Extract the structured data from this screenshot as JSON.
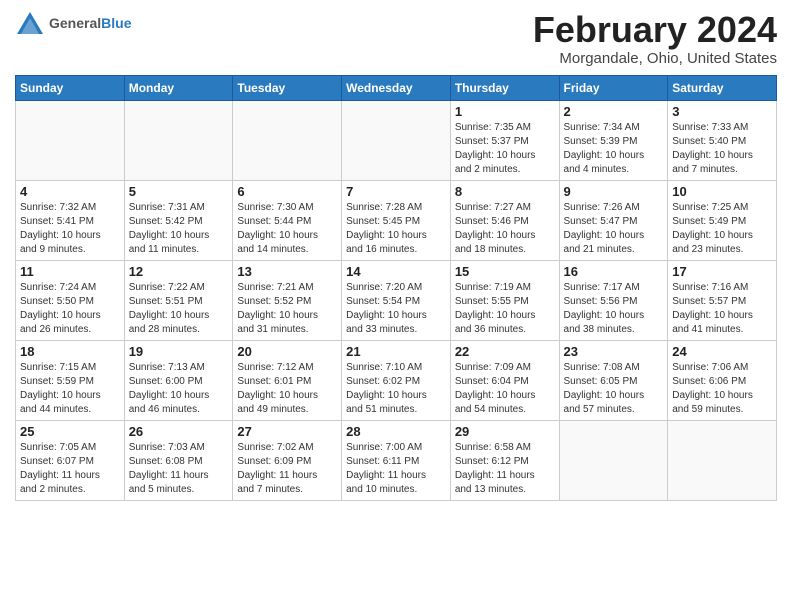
{
  "header": {
    "logo_general": "General",
    "logo_blue": "Blue",
    "main_title": "February 2024",
    "subtitle": "Morgandale, Ohio, United States"
  },
  "calendar": {
    "days_of_week": [
      "Sunday",
      "Monday",
      "Tuesday",
      "Wednesday",
      "Thursday",
      "Friday",
      "Saturday"
    ],
    "weeks": [
      [
        {
          "num": "",
          "info": ""
        },
        {
          "num": "",
          "info": ""
        },
        {
          "num": "",
          "info": ""
        },
        {
          "num": "",
          "info": ""
        },
        {
          "num": "1",
          "info": "Sunrise: 7:35 AM\nSunset: 5:37 PM\nDaylight: 10 hours\nand 2 minutes."
        },
        {
          "num": "2",
          "info": "Sunrise: 7:34 AM\nSunset: 5:39 PM\nDaylight: 10 hours\nand 4 minutes."
        },
        {
          "num": "3",
          "info": "Sunrise: 7:33 AM\nSunset: 5:40 PM\nDaylight: 10 hours\nand 7 minutes."
        }
      ],
      [
        {
          "num": "4",
          "info": "Sunrise: 7:32 AM\nSunset: 5:41 PM\nDaylight: 10 hours\nand 9 minutes."
        },
        {
          "num": "5",
          "info": "Sunrise: 7:31 AM\nSunset: 5:42 PM\nDaylight: 10 hours\nand 11 minutes."
        },
        {
          "num": "6",
          "info": "Sunrise: 7:30 AM\nSunset: 5:44 PM\nDaylight: 10 hours\nand 14 minutes."
        },
        {
          "num": "7",
          "info": "Sunrise: 7:28 AM\nSunset: 5:45 PM\nDaylight: 10 hours\nand 16 minutes."
        },
        {
          "num": "8",
          "info": "Sunrise: 7:27 AM\nSunset: 5:46 PM\nDaylight: 10 hours\nand 18 minutes."
        },
        {
          "num": "9",
          "info": "Sunrise: 7:26 AM\nSunset: 5:47 PM\nDaylight: 10 hours\nand 21 minutes."
        },
        {
          "num": "10",
          "info": "Sunrise: 7:25 AM\nSunset: 5:49 PM\nDaylight: 10 hours\nand 23 minutes."
        }
      ],
      [
        {
          "num": "11",
          "info": "Sunrise: 7:24 AM\nSunset: 5:50 PM\nDaylight: 10 hours\nand 26 minutes."
        },
        {
          "num": "12",
          "info": "Sunrise: 7:22 AM\nSunset: 5:51 PM\nDaylight: 10 hours\nand 28 minutes."
        },
        {
          "num": "13",
          "info": "Sunrise: 7:21 AM\nSunset: 5:52 PM\nDaylight: 10 hours\nand 31 minutes."
        },
        {
          "num": "14",
          "info": "Sunrise: 7:20 AM\nSunset: 5:54 PM\nDaylight: 10 hours\nand 33 minutes."
        },
        {
          "num": "15",
          "info": "Sunrise: 7:19 AM\nSunset: 5:55 PM\nDaylight: 10 hours\nand 36 minutes."
        },
        {
          "num": "16",
          "info": "Sunrise: 7:17 AM\nSunset: 5:56 PM\nDaylight: 10 hours\nand 38 minutes."
        },
        {
          "num": "17",
          "info": "Sunrise: 7:16 AM\nSunset: 5:57 PM\nDaylight: 10 hours\nand 41 minutes."
        }
      ],
      [
        {
          "num": "18",
          "info": "Sunrise: 7:15 AM\nSunset: 5:59 PM\nDaylight: 10 hours\nand 44 minutes."
        },
        {
          "num": "19",
          "info": "Sunrise: 7:13 AM\nSunset: 6:00 PM\nDaylight: 10 hours\nand 46 minutes."
        },
        {
          "num": "20",
          "info": "Sunrise: 7:12 AM\nSunset: 6:01 PM\nDaylight: 10 hours\nand 49 minutes."
        },
        {
          "num": "21",
          "info": "Sunrise: 7:10 AM\nSunset: 6:02 PM\nDaylight: 10 hours\nand 51 minutes."
        },
        {
          "num": "22",
          "info": "Sunrise: 7:09 AM\nSunset: 6:04 PM\nDaylight: 10 hours\nand 54 minutes."
        },
        {
          "num": "23",
          "info": "Sunrise: 7:08 AM\nSunset: 6:05 PM\nDaylight: 10 hours\nand 57 minutes."
        },
        {
          "num": "24",
          "info": "Sunrise: 7:06 AM\nSunset: 6:06 PM\nDaylight: 10 hours\nand 59 minutes."
        }
      ],
      [
        {
          "num": "25",
          "info": "Sunrise: 7:05 AM\nSunset: 6:07 PM\nDaylight: 11 hours\nand 2 minutes."
        },
        {
          "num": "26",
          "info": "Sunrise: 7:03 AM\nSunset: 6:08 PM\nDaylight: 11 hours\nand 5 minutes."
        },
        {
          "num": "27",
          "info": "Sunrise: 7:02 AM\nSunset: 6:09 PM\nDaylight: 11 hours\nand 7 minutes."
        },
        {
          "num": "28",
          "info": "Sunrise: 7:00 AM\nSunset: 6:11 PM\nDaylight: 11 hours\nand 10 minutes."
        },
        {
          "num": "29",
          "info": "Sunrise: 6:58 AM\nSunset: 6:12 PM\nDaylight: 11 hours\nand 13 minutes."
        },
        {
          "num": "",
          "info": ""
        },
        {
          "num": "",
          "info": ""
        }
      ]
    ]
  }
}
